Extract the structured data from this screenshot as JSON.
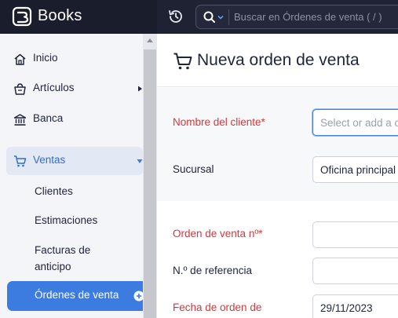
{
  "app": {
    "brand": "Books"
  },
  "search": {
    "placeholder": "Buscar en Órdenes de venta ( / )"
  },
  "sidebar": {
    "items": [
      {
        "label": "Inicio",
        "icon": "home-icon"
      },
      {
        "label": "Artículos",
        "icon": "basket-icon"
      },
      {
        "label": "Banca",
        "icon": "bank-icon"
      },
      {
        "label": "Ventas",
        "icon": "cart-icon"
      }
    ],
    "sales_sub": [
      "Clientes",
      "Estimaciones",
      "Facturas de",
      "anticipo",
      "Órdenes de venta"
    ]
  },
  "page": {
    "title": "Nueva orden de venta"
  },
  "form": {
    "customer_label": "Nombre del cliente*",
    "customer_placeholder": "Select or add a customer",
    "branch_label": "Sucursal",
    "branch_value": "Oficina principal",
    "order_no_label": "Orden de venta nº*",
    "reference_label": "N.º de referencia",
    "order_date_label": "Fecha de orden de",
    "order_date_value": "29/11/2023"
  },
  "colors": {
    "topbar": "#1f2233",
    "accent": "#3c7be0",
    "required": "#d6363b"
  }
}
